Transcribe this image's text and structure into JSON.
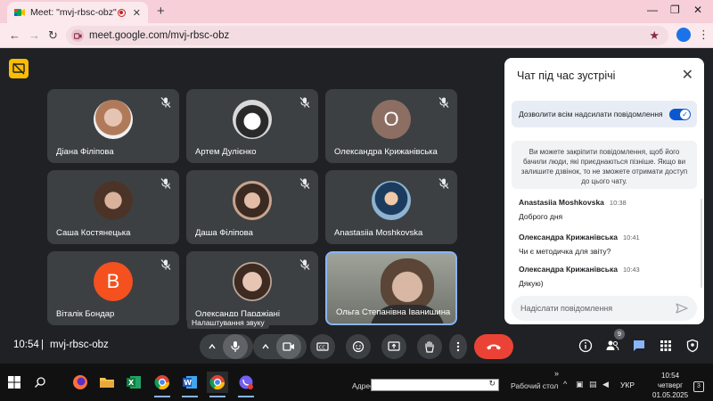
{
  "browser": {
    "tab_title": "Meet: \"mvj-rbsc-obz\"",
    "url": "meet.google.com/mvj-rbsc-obz"
  },
  "participants": [
    {
      "name": "Діана Філіпова",
      "avatar": "photo",
      "muted": true
    },
    {
      "name": "Артем Дулієнко",
      "avatar": "photo",
      "muted": true
    },
    {
      "name": "Олександра Крижанівська",
      "avatar": "letter",
      "initial": "О",
      "color": "#8d6e63",
      "muted": true
    },
    {
      "name": "Саша Костянецька",
      "avatar": "photo",
      "muted": true
    },
    {
      "name": "Даша Філіпова",
      "avatar": "photo",
      "muted": true
    },
    {
      "name": "Anastasiia Moshkovska",
      "avatar": "photo",
      "muted": true
    },
    {
      "name": "Віталік Бондар",
      "avatar": "letter",
      "initial": "В",
      "color": "#f4511e",
      "muted": true
    },
    {
      "name": "Олександр Парджіані",
      "avatar": "photo",
      "muted": true
    },
    {
      "name": "Ольга Степанівна Іванишина",
      "avatar": "video",
      "muted": false
    }
  ],
  "chat": {
    "title": "Чат під час зустрічі",
    "allow_label": "Дозволити всім надсилати повідомлення",
    "notice": "Ви можете закріпити повідомлення, щоб його бачили люди, які приєднаються пізніше. Якщо ви залишите дзвінок, то не зможете отримати доступ до цього чату.",
    "messages": [
      {
        "sender": "Anastasiia Moshkovska",
        "time": "10:38",
        "text": "Доброго дня"
      },
      {
        "sender": "Олександра Крижанівська",
        "time": "10:41",
        "text": "Чи є методичка для звіту?"
      },
      {
        "sender": "Олександра Крижанівська",
        "time": "10:43",
        "text": "Дякую)"
      }
    ],
    "input_placeholder": "Надіслати повідомлення"
  },
  "bottom_bar": {
    "time": "10:54",
    "separator": "|",
    "meeting_code": "mvj-rbsc-obz",
    "tooltip": "Налаштування звуку",
    "participants_count": "9"
  },
  "taskbar": {
    "address_label": "Адрес",
    "desktop_label": "Рабочий стол",
    "overflow": "»",
    "language": "УКР",
    "time": "10:54",
    "weekday": "четверг",
    "date": "01.05.2025",
    "notifications": "3"
  },
  "colors": {
    "meet_bg": "#202124",
    "tile_bg": "#3c4043",
    "hangup": "#ea4335",
    "accent": "#0b57d0",
    "chrome_tab": "#f6cfd8"
  }
}
